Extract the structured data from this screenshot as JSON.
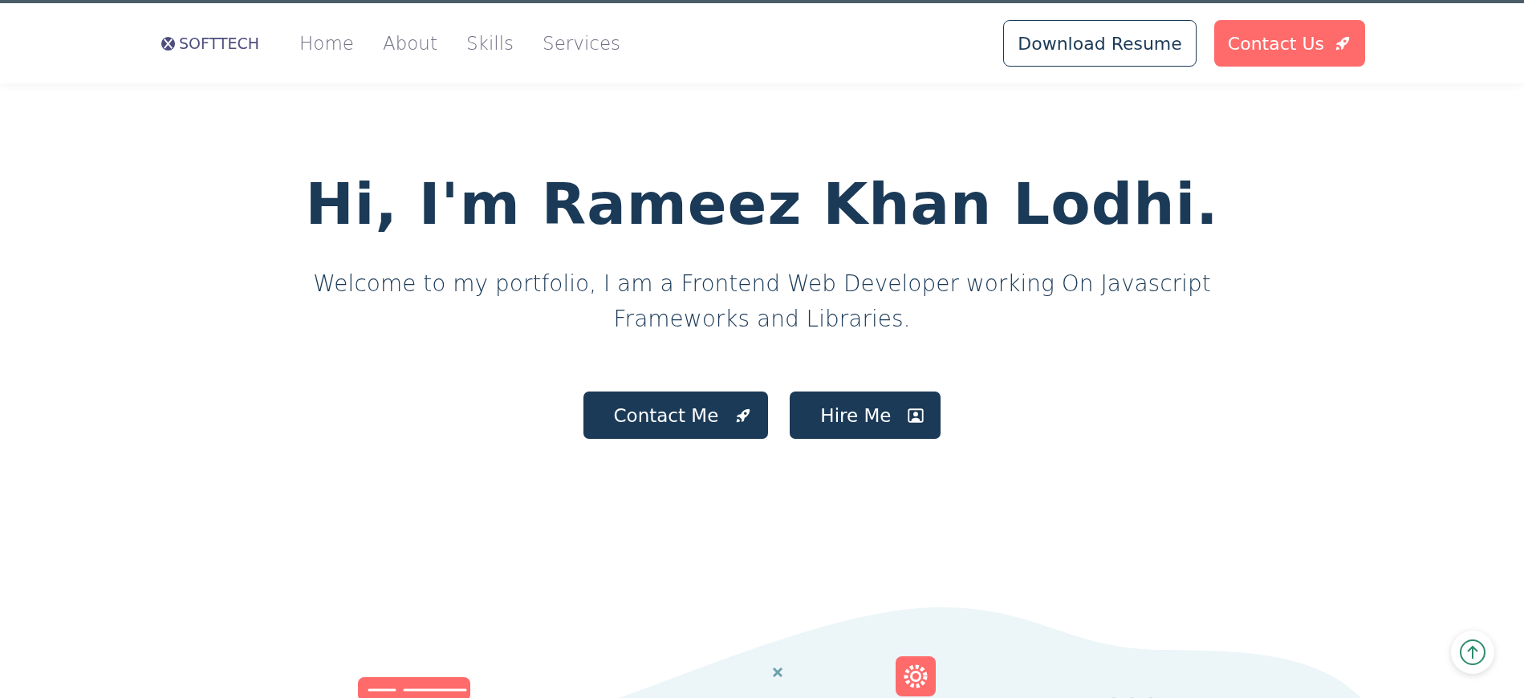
{
  "brand": {
    "name": "SOFTTECH"
  },
  "nav": {
    "links": [
      {
        "label": "Home"
      },
      {
        "label": "About"
      },
      {
        "label": "Skills"
      },
      {
        "label": "Services"
      }
    ],
    "buttons": [
      {
        "label": "Download Resume",
        "kind": "outline"
      },
      {
        "label": "Contact Us",
        "kind": "filled"
      }
    ]
  },
  "hero": {
    "title": "Hi, I'm Rameez Khan Lodhi.",
    "subtitle": "Welcome to my portfolio, I am a Frontend Web Developer working On Javascript Frameworks and Libraries.",
    "buttons": [
      {
        "label": "Contact Me",
        "kind": "rocket"
      },
      {
        "label": "Hire Me",
        "kind": "person"
      }
    ]
  }
}
